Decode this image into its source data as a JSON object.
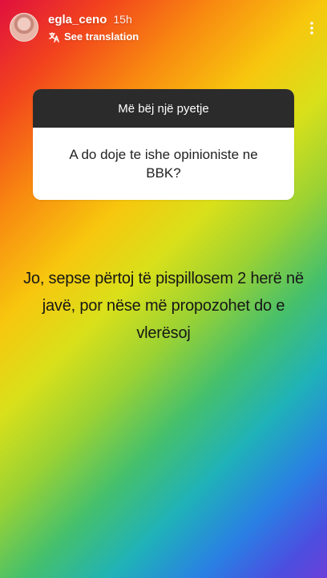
{
  "header": {
    "username": "egla_ceno",
    "time": "15h",
    "see_translation": "See translation"
  },
  "icons": {
    "avatar": "profile-avatar",
    "translate": "translate-icon",
    "more": "more-vertical-icon"
  },
  "question_card": {
    "title": "Më bëj një pyetje",
    "question": "A do doje te ishe opinioniste ne BBK?"
  },
  "answer": {
    "text": "Jo, sepse përtoj të pispillosem 2 herë në javë, por nëse më propozohet do e vlerësoj"
  }
}
